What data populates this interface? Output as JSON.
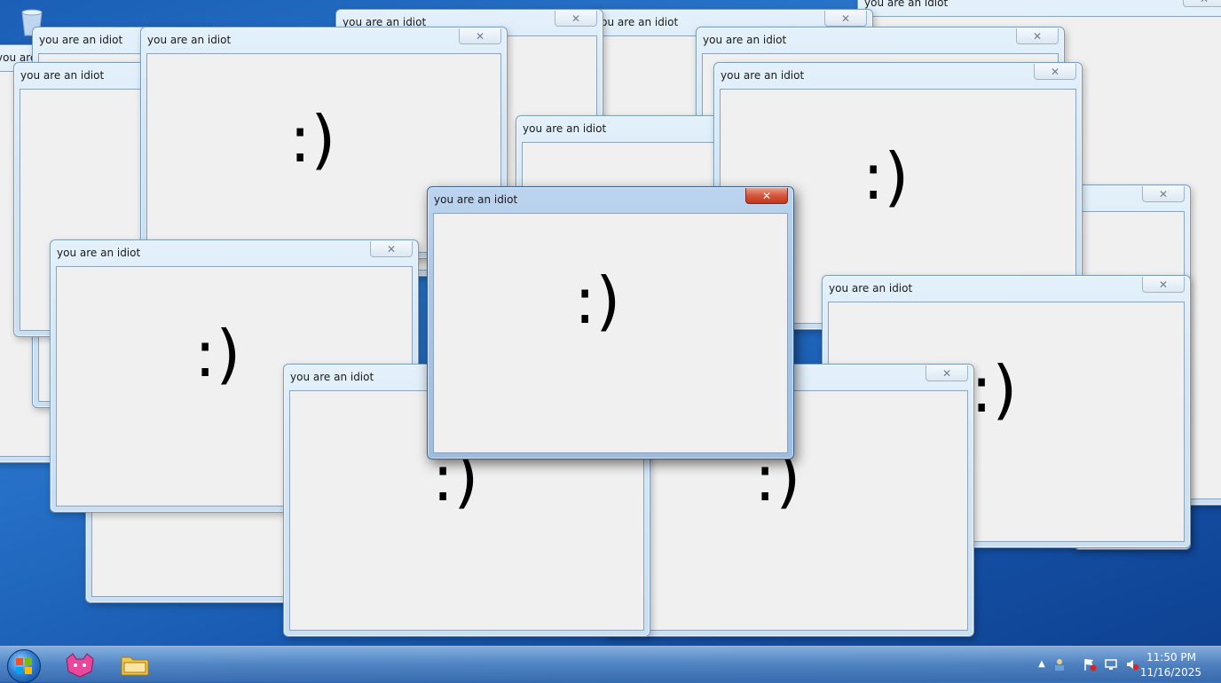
{
  "popup": {
    "title": "you are an idiot",
    "message": ":)",
    "close_symbol": "✕"
  },
  "windows": [
    {
      "id": "w-far-top-right",
      "title": "you are an idiot",
      "smile": false
    },
    {
      "id": "w-top-center-2",
      "title": "you are an idiot",
      "smile": false
    },
    {
      "id": "w-top-center-1",
      "title": "you are an idiot",
      "smile": false
    },
    {
      "id": "w-top-left-a",
      "title": "you are an idiot",
      "smile": false
    },
    {
      "id": "w-top-left-b",
      "title": "you are an idiot",
      "smile": false
    },
    {
      "id": "w-top-left-c",
      "title": "you are an idiot",
      "smile": false
    },
    {
      "id": "w-upper-left-big",
      "title": "you are an idiot",
      "smile": true
    },
    {
      "id": "w-upper-right-a",
      "title": "you are an idiot",
      "smile": false
    },
    {
      "id": "w-center-small",
      "title": "you are an idiot",
      "smile": false
    },
    {
      "id": "w-upper-right-big",
      "title": "you are an idiot",
      "smile": true
    },
    {
      "id": "w-right-mid",
      "title": "you are an idiot",
      "smile": true
    },
    {
      "id": "w-left-mid",
      "title": "you are an idiot",
      "smile": true
    },
    {
      "id": "w-bottom-center",
      "title": "you are an idiot",
      "smile": true
    },
    {
      "id": "w-bottom-right",
      "title": "you are an idiot",
      "smile": true
    },
    {
      "id": "w-active",
      "title": "you are an idiot",
      "smile": true
    }
  ],
  "taskbar": {
    "start_icon": "windows-orb-icon",
    "pinned": [
      "paint-cat-icon",
      "folder-icon"
    ],
    "tray_icons": [
      "chevron-up-icon",
      "network-user-icon",
      "flag-error-icon",
      "display-icon",
      "speaker-muted-icon"
    ],
    "clock_time": "11:50 PM",
    "clock_date": "11/16/2025"
  },
  "colors": {
    "active_close": "#c0381f",
    "client_bg": "#f0f0f0",
    "desktop": "#1b5fb6"
  }
}
